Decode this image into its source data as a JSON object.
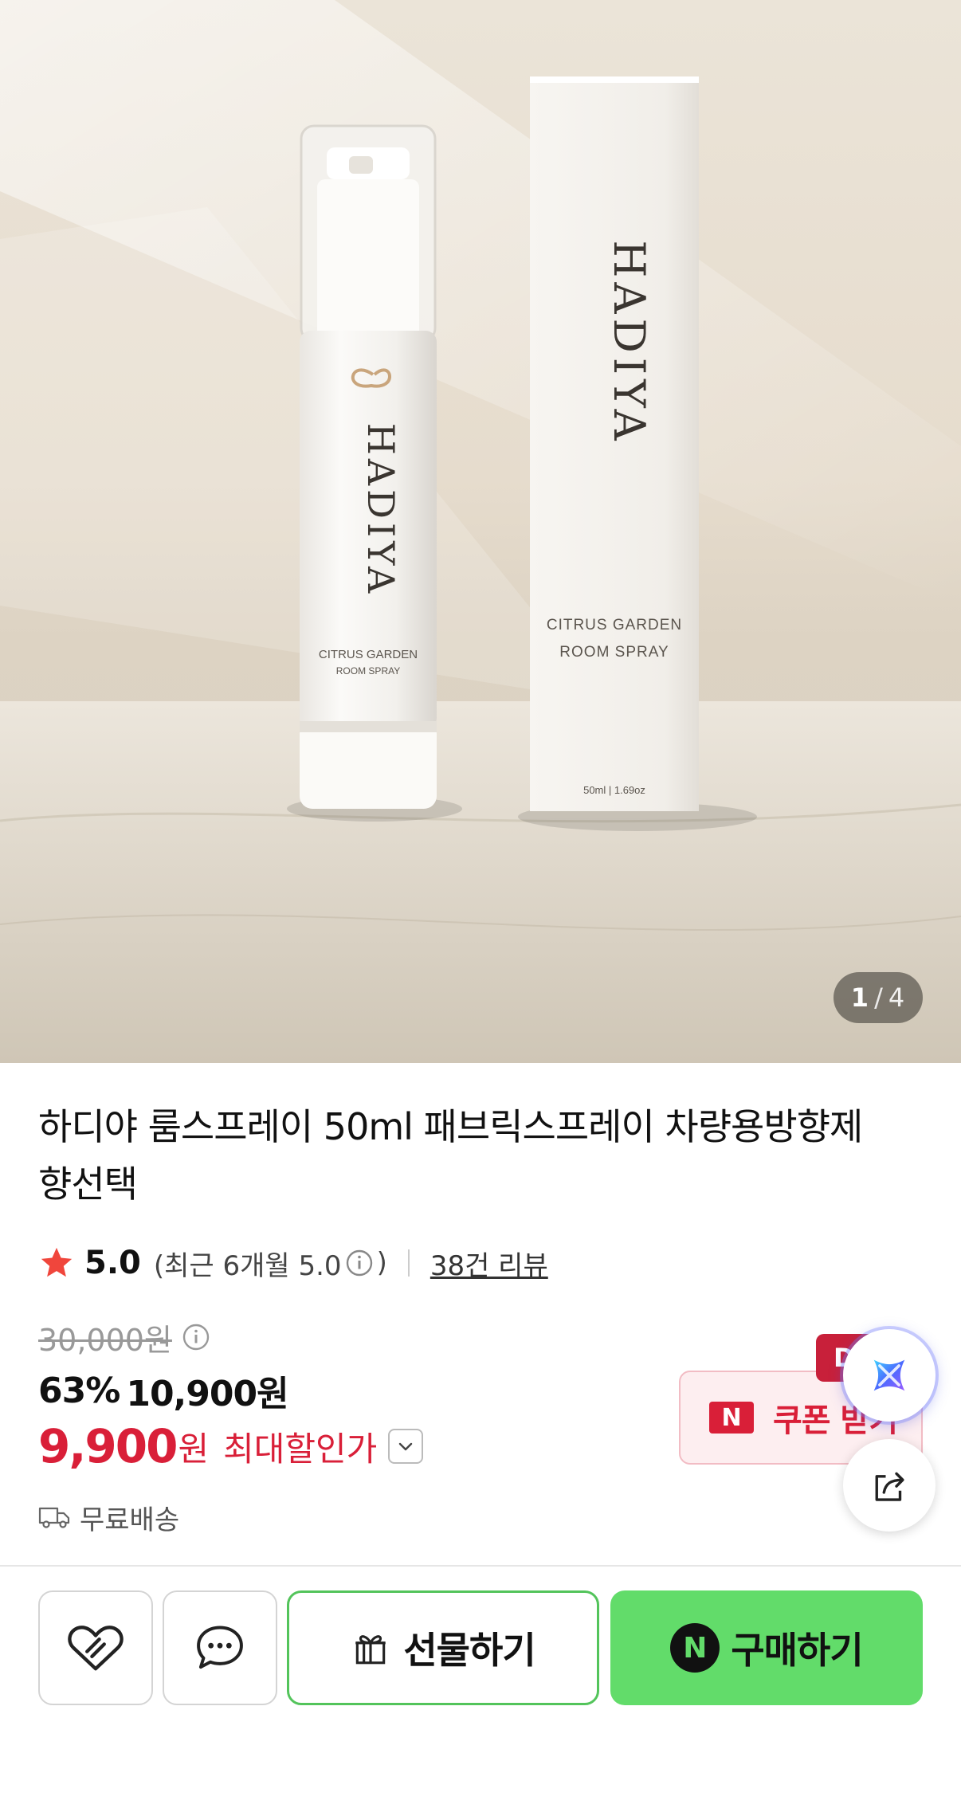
{
  "gallery": {
    "current": "1",
    "separator": "/",
    "total": "4",
    "bottle_label_line1": "CITRUS GARDEN",
    "bottle_label_line2": "ROOM SPRAY",
    "box_label_line1": "CITRUS GARDEN",
    "box_label_line2": "ROOM SPRAY",
    "box_volume": "50ml | 1.69oz",
    "brand_logo": "HADIYA"
  },
  "product": {
    "title": "하디야 룸스프레이 50ml 패브릭스프레이 차량용방향제 향선택"
  },
  "rating": {
    "score": "5.0",
    "recent": "(최근 6개월 5.0",
    "recent_close": ")",
    "reviews": "38건 리뷰"
  },
  "price": {
    "original": "30,000원",
    "discount_rate": "63%",
    "discounted": "10,900원",
    "max_price": "9,900",
    "max_won": "원",
    "max_label": "최대할인가"
  },
  "shipping": {
    "label": "무료배송"
  },
  "coupon": {
    "badge": "N",
    "label": "쿠폰 받기",
    "tag": "D"
  },
  "actions": {
    "gift_label": "선물하기",
    "buy_badge": "N",
    "buy_label": "구매하기"
  },
  "icons": {
    "star": "star-icon",
    "info": "info-icon",
    "chevron": "chevron-down-icon",
    "truck": "truck-icon",
    "heart": "heart-icon",
    "chat": "chat-bubble-icon",
    "gift": "gift-icon",
    "ai": "ai-assistant-icon",
    "share": "share-icon"
  },
  "colors": {
    "accent_red": "#d91f38",
    "buy_green": "#62dc6a",
    "gift_border": "#53c45b"
  }
}
